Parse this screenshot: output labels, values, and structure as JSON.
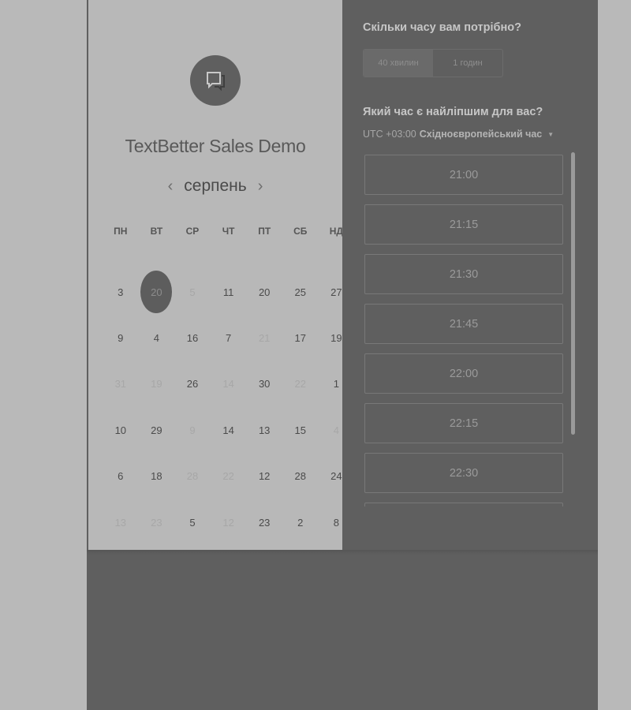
{
  "event": {
    "title": "TextBetter Sales Demo"
  },
  "calendar": {
    "month": "серпень",
    "prev_arrow": "‹",
    "next_arrow": "›",
    "weekdays": [
      "ПН",
      "ВТ",
      "СР",
      "ЧТ",
      "ПТ",
      "СБ",
      "НД"
    ],
    "days": [
      [
        "3",
        "20",
        "5",
        "11",
        "20",
        "25",
        "27"
      ],
      [
        "9",
        "4",
        "16",
        "7",
        "21",
        "17",
        "19"
      ],
      [
        "31",
        "19",
        "26",
        "14",
        "30",
        "22",
        "1"
      ],
      [
        "10",
        "29",
        "9",
        "14",
        "13",
        "15",
        "4"
      ],
      [
        "6",
        "18",
        "28",
        "22",
        "12",
        "28",
        "24"
      ],
      [
        "13",
        "23",
        "5",
        "12",
        "23",
        "2",
        "8"
      ]
    ],
    "selected": "20"
  },
  "booking": {
    "duration_question": "Скільки часу вам потрібно?",
    "durations": [
      "40 хвилин",
      "1 годин"
    ],
    "active_duration": "40 хвилин",
    "time_question": "Який час є найліпшим для вас?",
    "timezone_offset": "UTC +03:00",
    "timezone_name": "Східноєвропейський час",
    "slots": [
      "21:00",
      "21:15",
      "21:30",
      "21:45",
      "22:00",
      "22:15",
      "22:30",
      ""
    ]
  },
  "colors": {
    "overlay": "#5f5f5f",
    "left_panel": "#b8b8b8",
    "page_bg": "#b9b9b9"
  },
  "icons": {
    "logo": "chat-bubble-icon",
    "timezone_caret": "caret-down-icon"
  }
}
